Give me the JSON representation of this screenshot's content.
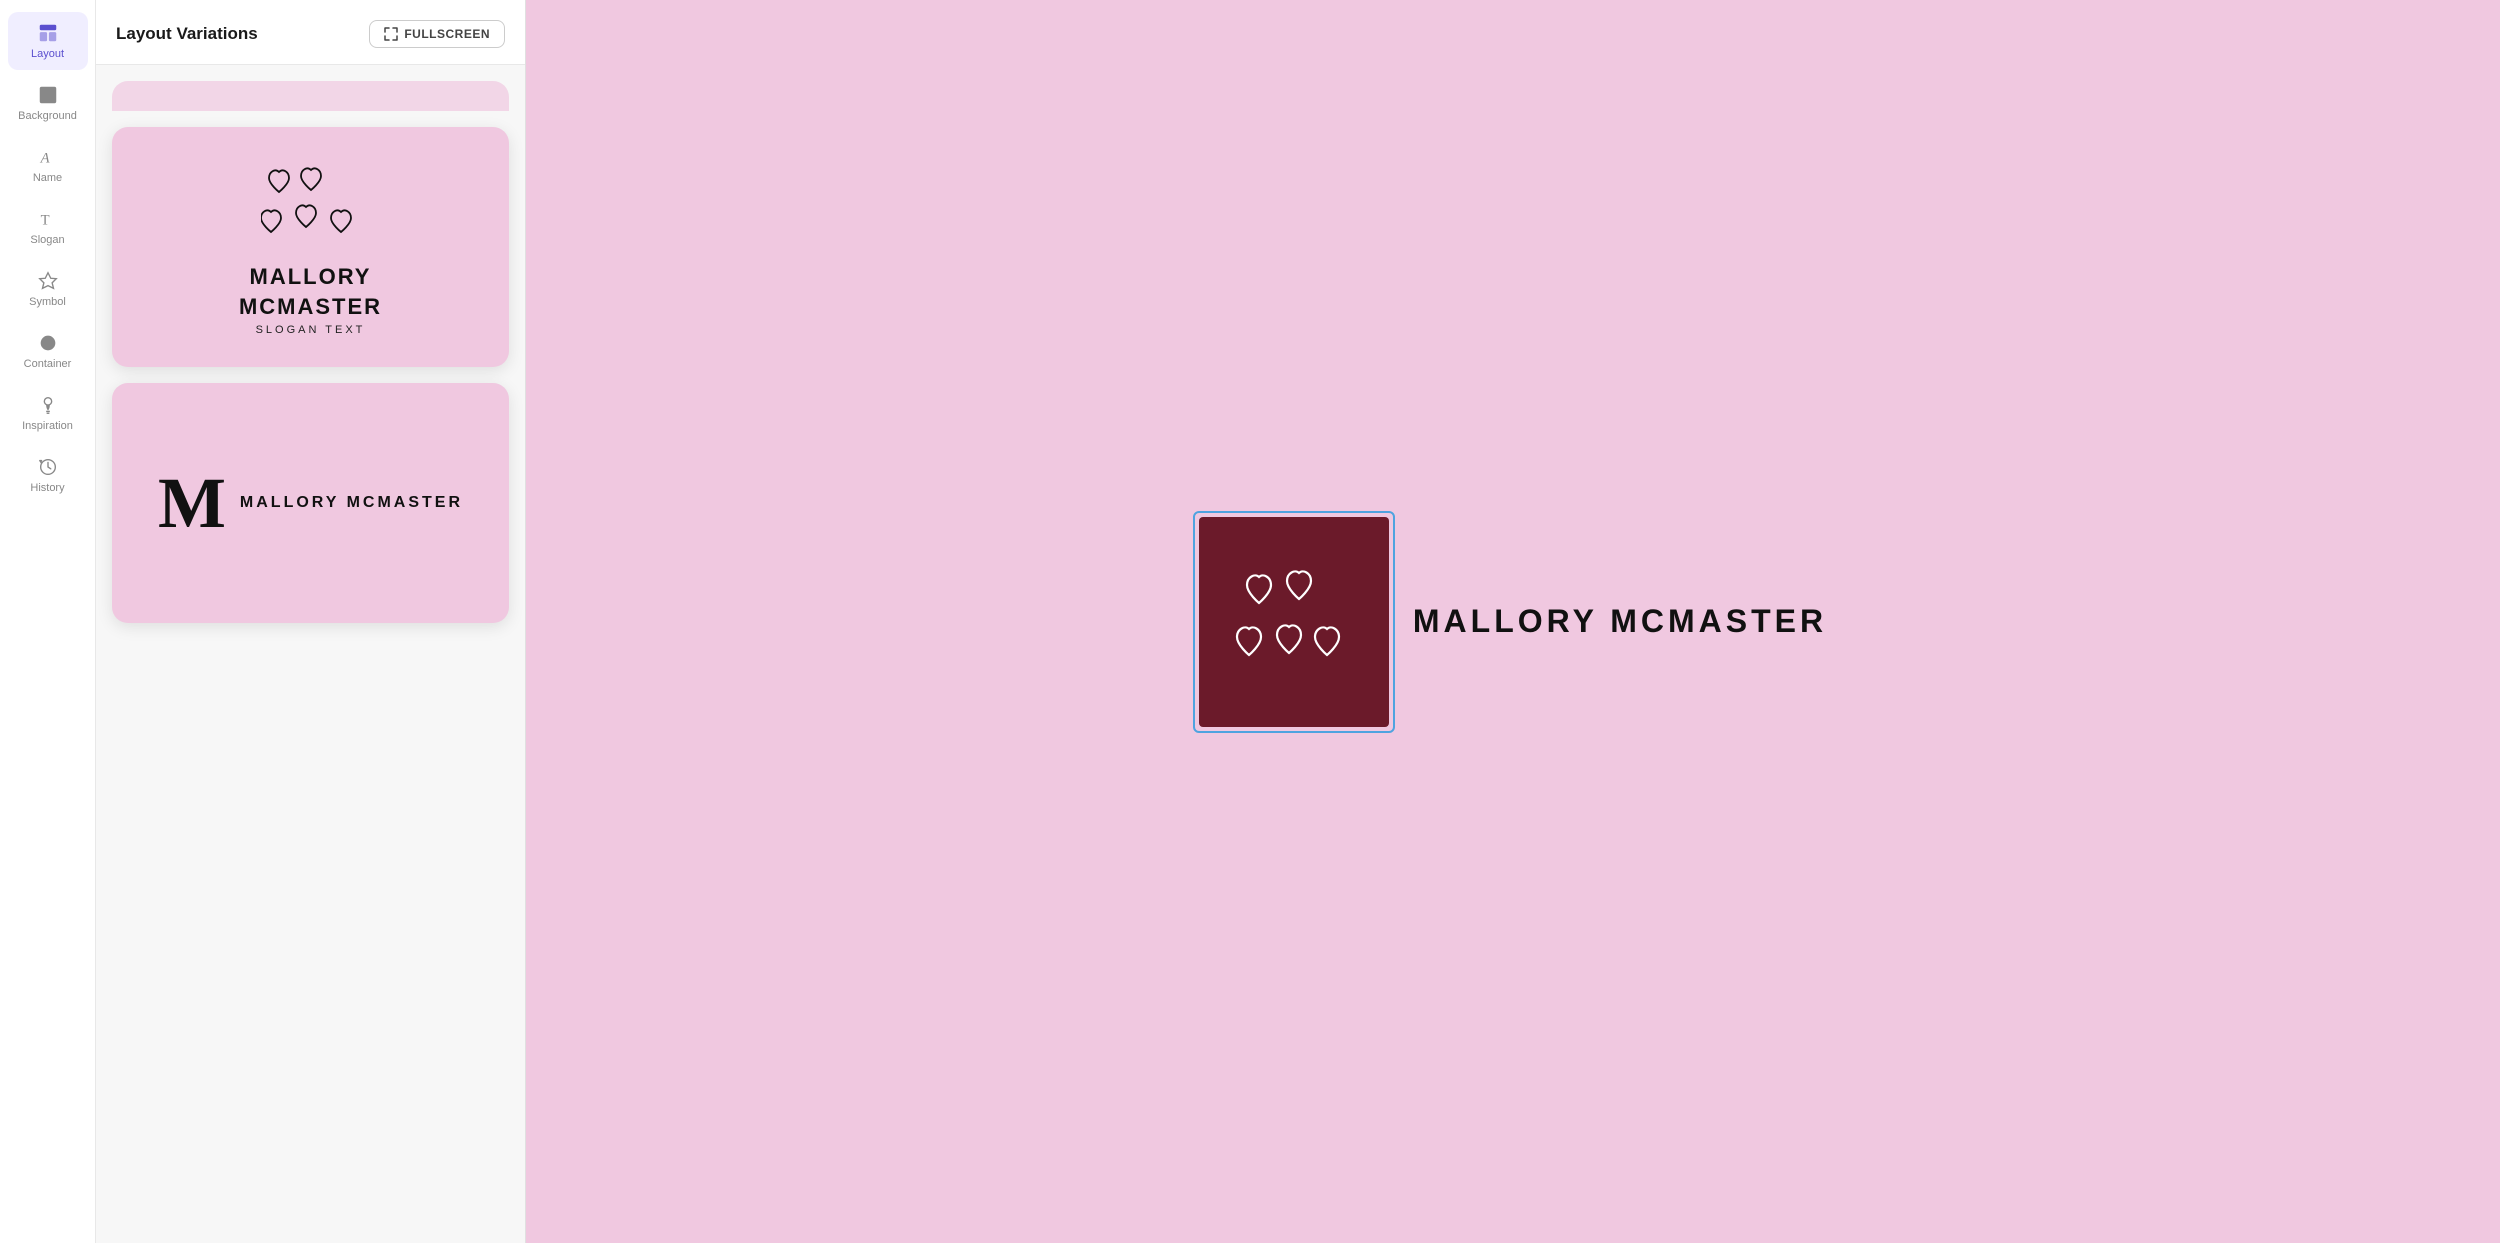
{
  "sidebar": {
    "items": [
      {
        "id": "layout",
        "label": "Layout",
        "active": true
      },
      {
        "id": "background",
        "label": "Background",
        "active": false
      },
      {
        "id": "name",
        "label": "Name",
        "active": false
      },
      {
        "id": "slogan",
        "label": "Slogan",
        "active": false
      },
      {
        "id": "symbol",
        "label": "Symbol",
        "active": false
      },
      {
        "id": "container",
        "label": "Container",
        "active": false
      },
      {
        "id": "inspiration",
        "label": "Inspiration",
        "active": false
      },
      {
        "id": "history",
        "label": "History",
        "active": false
      }
    ]
  },
  "left_panel": {
    "title": "Layout Variations",
    "fullscreen_label": "FULLSCREEN"
  },
  "cards": [
    {
      "id": "card1",
      "type": "hearts-stacked",
      "brand_name_line1": "MALLORY",
      "brand_name_line2": "MCMASTER",
      "slogan": "SLOGAN TEXT"
    },
    {
      "id": "card2",
      "type": "monogram",
      "monogram": "M",
      "brand_name": "MALLORY MCMASTER"
    }
  ],
  "preview": {
    "brand_name": "MALLORY MCMASTER",
    "background_color": "#f0c8e0",
    "symbol_bg_color": "#6b1a2a"
  },
  "colors": {
    "pink_bg": "#f0c8e0",
    "dark_red": "#6b1a2a",
    "sidebar_active_bg": "#f0eeff",
    "sidebar_active_text": "#5b4fcf",
    "selection_border": "#4fa3e0"
  }
}
